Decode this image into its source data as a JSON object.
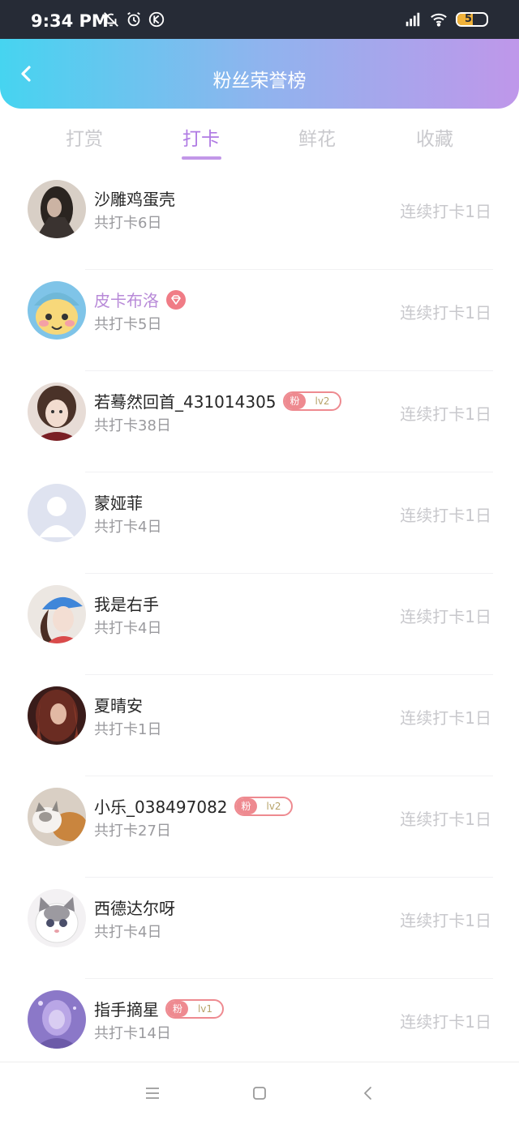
{
  "status_bar": {
    "time": "9:34 PM",
    "battery": "53",
    "battery_level": 0.53,
    "icons_left": [
      "bell-off-icon",
      "alarm-icon",
      "k-app-icon"
    ],
    "icons_right": [
      "signal-icon",
      "wifi-icon",
      "battery-icon"
    ]
  },
  "header": {
    "title": "粉丝荣誉榜",
    "back_icon": "chevron-left-icon",
    "gradient": [
      "#46d4f0",
      "#bf97ea"
    ]
  },
  "tabs": [
    {
      "label": "打赏",
      "active": false
    },
    {
      "label": "打卡",
      "active": true
    },
    {
      "label": "鲜花",
      "active": false
    },
    {
      "label": "收藏",
      "active": false
    }
  ],
  "accent_color": "#b07be3",
  "rows": [
    {
      "name": "沙雕鸡蛋壳",
      "count": "共打卡6日",
      "streak": "连续打卡1日",
      "vip": false,
      "badge": null
    },
    {
      "name": "皮卡布洛",
      "count": "共打卡5日",
      "streak": "连续打卡1日",
      "vip": true,
      "badge": null
    },
    {
      "name": "若蓦然回首_431014305",
      "count": "共打卡38日",
      "streak": "连续打卡1日",
      "vip": false,
      "badge": {
        "tag": "粉",
        "level": "lv2"
      }
    },
    {
      "name": "蒙娅菲",
      "count": "共打卡4日",
      "streak": "连续打卡1日",
      "vip": false,
      "badge": null
    },
    {
      "name": "我是右手",
      "count": "共打卡4日",
      "streak": "连续打卡1日",
      "vip": false,
      "badge": null
    },
    {
      "name": "夏晴安",
      "count": "共打卡1日",
      "streak": "连续打卡1日",
      "vip": false,
      "badge": null
    },
    {
      "name": "小乐_038497082",
      "count": "共打卡27日",
      "streak": "连续打卡1日",
      "vip": false,
      "badge": {
        "tag": "粉",
        "level": "lv2"
      }
    },
    {
      "name": "西德达尔呀",
      "count": "共打卡4日",
      "streak": "连续打卡1日",
      "vip": false,
      "badge": null
    },
    {
      "name": "指手摘星",
      "count": "共打卡14日",
      "streak": "连续打卡1日",
      "vip": false,
      "badge": {
        "tag": "粉",
        "level": "lv1"
      }
    }
  ],
  "nav_bar": [
    "menu-icon",
    "home-square-icon",
    "back-triangle-icon"
  ]
}
